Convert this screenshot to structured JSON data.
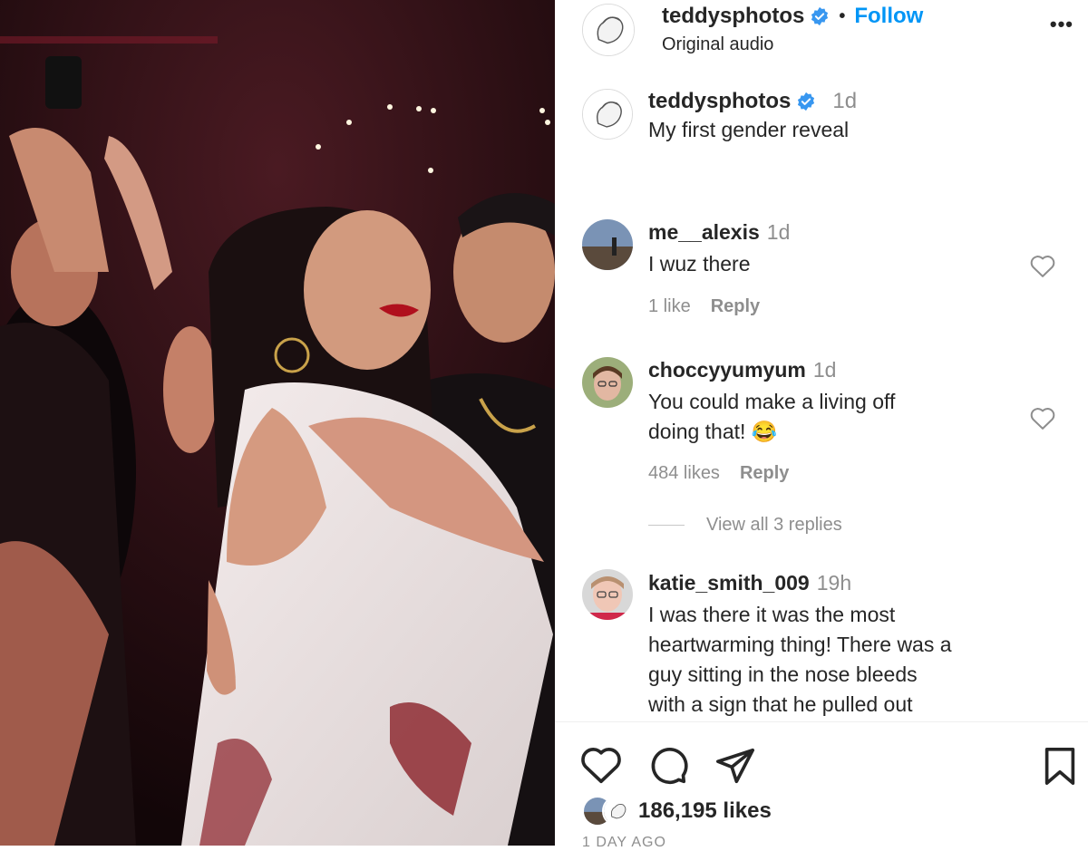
{
  "post": {
    "username": "teddysphotos",
    "follow_label": "Follow",
    "dot": "•",
    "audio": "Original audio",
    "more": "•••"
  },
  "caption": {
    "username": "teddysphotos",
    "time": "1d",
    "text": "My first gender reveal"
  },
  "comments": [
    {
      "username": "me__alexis",
      "time": "1d",
      "lines": [
        "I wuz there"
      ],
      "likes": "1 like",
      "reply": "Reply"
    },
    {
      "username": "choccyyumyum",
      "time": "1d",
      "lines": [
        "You could make a living off",
        "doing that! 😂"
      ],
      "likes": "484 likes",
      "reply": "Reply",
      "view_replies": "View all 3 replies"
    },
    {
      "username": "katie_smith_009",
      "time": "19h",
      "lines": [
        "I was there it was the most",
        "heartwarming thing! There was a",
        "guy sitting in the nose bleeds",
        "with a sign that he pulled out"
      ]
    }
  ],
  "footer": {
    "likes": "186,195 likes",
    "ago": "1 DAY AGO"
  },
  "icons": {
    "like": "heart-icon",
    "comment": "comment-bubble-icon",
    "share": "paper-plane-icon",
    "save": "bookmark-icon",
    "verified": "verified-badge-icon"
  },
  "colors": {
    "follow": "#0095f6",
    "verified": "#3897f0",
    "muted": "#8e8e8e"
  }
}
